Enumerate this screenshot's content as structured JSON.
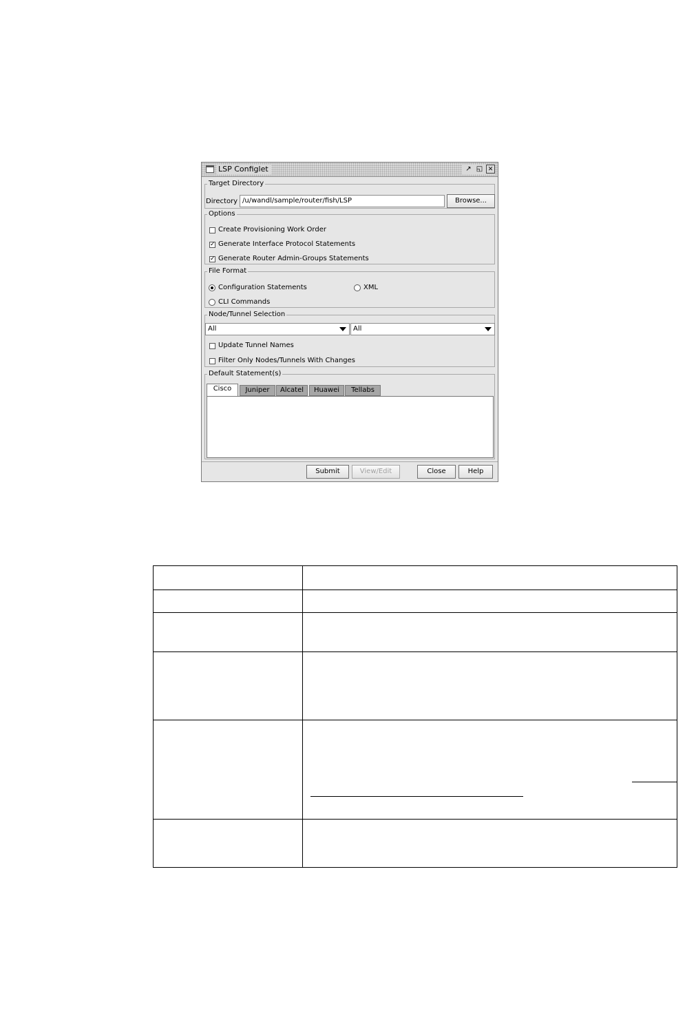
{
  "window": {
    "title": "LSP Configlet",
    "title_buttons": [
      "restore-icon",
      "maximize-icon",
      "close-icon"
    ]
  },
  "target_directory": {
    "legend": "Target Directory",
    "label": "Directory :",
    "value": "/u/wandl/sample/router/fish/LSP",
    "browse_label": "Browse..."
  },
  "options": {
    "legend": "Options",
    "items": [
      {
        "label": "Create Provisioning Work Order",
        "checked": false
      },
      {
        "label": "Generate Interface Protocol Statements",
        "checked": true
      },
      {
        "label": "Generate Router Admin-Groups Statements",
        "checked": true
      }
    ]
  },
  "file_format": {
    "legend": "File Format",
    "options": [
      {
        "label": "Configuration Statements",
        "selected": true
      },
      {
        "label": "XML",
        "selected": false
      },
      {
        "label": "CLI Commands",
        "selected": false
      }
    ]
  },
  "node_tunnel_selection": {
    "legend": "Node/Tunnel Selection",
    "combo1": "All",
    "combo2": "All",
    "update_tunnel_names": {
      "label": "Update Tunnel Names",
      "checked": false
    },
    "filter_changes": {
      "label": "Filter Only Nodes/Tunnels With Changes",
      "checked": false
    }
  },
  "default_statements": {
    "legend": "Default Statement(s)",
    "tabs": [
      "Cisco",
      "Juniper",
      "Alcatel",
      "Huawei",
      "Tellabs"
    ],
    "active_tab": "Cisco",
    "content": ""
  },
  "footer": {
    "submit": "Submit",
    "view_edit": "View/Edit",
    "close": "Close",
    "help": "Help"
  },
  "table": {
    "rows": [
      [
        "",
        ""
      ],
      [
        "",
        ""
      ],
      [
        "",
        ""
      ],
      [
        "",
        ""
      ],
      [
        "",
        ""
      ],
      [
        "",
        ""
      ]
    ]
  }
}
